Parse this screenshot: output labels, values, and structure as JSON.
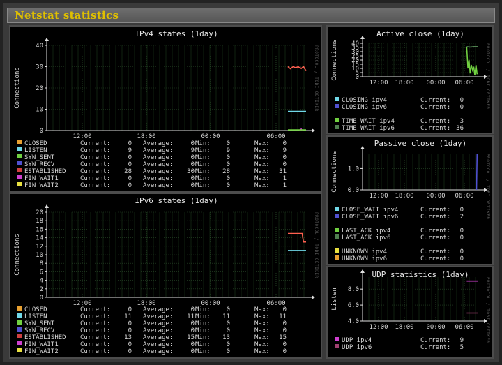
{
  "window": {
    "title": "Netstat statistics"
  },
  "watermark": "PROTOCOL / TOBI OETIKER",
  "panels": [
    {
      "id": "ipv4",
      "title": "IPv4 states  (1day)",
      "ylabel": "Connections",
      "yticks": [
        0,
        10,
        20,
        30,
        40
      ],
      "xticks": [
        "12:00",
        "18:00",
        "00:00",
        "06:00"
      ],
      "stats_cols": [
        "Current:",
        "Average:",
        "Min:",
        "Max:"
      ],
      "legend": [
        {
          "name": "CLOSED",
          "color": "#e8a030",
          "current": "0",
          "average": "0",
          "min": "0",
          "max": "0"
        },
        {
          "name": "LISTEN",
          "color": "#70d8e8",
          "current": "9",
          "average": "9",
          "min": "9",
          "max": "9"
        },
        {
          "name": "SYN_SENT",
          "color": "#70d040",
          "current": "0",
          "average": "0",
          "min": "0",
          "max": "0"
        },
        {
          "name": "SYN_RECV",
          "color": "#5050d0",
          "current": "0",
          "average": "0",
          "min": "0",
          "max": "0"
        },
        {
          "name": "ESTABLISHED",
          "color": "#d04040",
          "current": "28",
          "average": "30",
          "min": "28",
          "max": "31"
        },
        {
          "name": "FIN_WAIT1",
          "color": "#d040d0",
          "current": "0",
          "average": "0",
          "min": "0",
          "max": "1"
        },
        {
          "name": "FIN_WAIT2",
          "color": "#e8e040",
          "current": "0",
          "average": "0",
          "min": "0",
          "max": "1"
        }
      ]
    },
    {
      "id": "ipv6",
      "title": "IPv6 states  (1day)",
      "ylabel": "Connections",
      "yticks": [
        0,
        2,
        4,
        6,
        8,
        10,
        12,
        14,
        16,
        18,
        20
      ],
      "xticks": [
        "12:00",
        "18:00",
        "00:00",
        "06:00"
      ],
      "stats_cols": [
        "Current:",
        "Average:",
        "Min:",
        "Max:"
      ],
      "legend": [
        {
          "name": "CLOSED",
          "color": "#e8a030",
          "current": "0",
          "average": "0",
          "min": "0",
          "max": "0"
        },
        {
          "name": "LISTEN",
          "color": "#70d8e8",
          "current": "11",
          "average": "11",
          "min": "11",
          "max": "11"
        },
        {
          "name": "SYN_SENT",
          "color": "#70d040",
          "current": "0",
          "average": "0",
          "min": "0",
          "max": "0"
        },
        {
          "name": "SYN_RECV",
          "color": "#5050d0",
          "current": "0",
          "average": "0",
          "min": "0",
          "max": "0"
        },
        {
          "name": "ESTABLISHED",
          "color": "#d04040",
          "current": "13",
          "average": "15",
          "min": "13",
          "max": "15"
        },
        {
          "name": "FIN_WAIT1",
          "color": "#d040d0",
          "current": "0",
          "average": "0",
          "min": "0",
          "max": "0"
        },
        {
          "name": "FIN_WAIT2",
          "color": "#e8e040",
          "current": "0",
          "average": "0",
          "min": "0",
          "max": "0"
        }
      ]
    },
    {
      "id": "active",
      "title": "Active close  (1day)",
      "ylabel": "Connections",
      "yticks": [
        0,
        5,
        10,
        15,
        20,
        25,
        30,
        35,
        40
      ],
      "xticks": [
        "12:00",
        "18:00",
        "00:00",
        "06:00"
      ],
      "stats_cols": [
        "Current:"
      ],
      "legend": [
        {
          "name": "CLOSING ipv4",
          "color": "#70d8e8",
          "current": "0"
        },
        {
          "name": "CLOSING ipv6",
          "color": "#5050d0",
          "current": "0"
        },
        {
          "name": "TIME_WAIT ipv4",
          "color": "#70d040",
          "current": "3"
        },
        {
          "name": "TIME_WAIT ipv6",
          "color": "#508050",
          "current": "36"
        }
      ]
    },
    {
      "id": "passive",
      "title": "Passive close  (1day)",
      "ylabel": "Connections",
      "yticks": [
        "0.0",
        "1.0"
      ],
      "xticks": [
        "12:00",
        "18:00",
        "00:00",
        "06:00"
      ],
      "stats_cols": [
        "Current:"
      ],
      "legend": [
        {
          "name": "CLOSE_WAIT ipv4",
          "color": "#70d8e8",
          "current": "0"
        },
        {
          "name": "CLOSE_WAIT ipv6",
          "color": "#5050d0",
          "current": "2"
        },
        {
          "name": "LAST_ACK ipv4",
          "color": "#70d040",
          "current": "0"
        },
        {
          "name": "LAST_ACK ipv6",
          "color": "#508050",
          "current": "0"
        },
        {
          "name": "UNKNOWN ipv4",
          "color": "#e8e040",
          "current": "0"
        },
        {
          "name": "UNKNOWN ipv6",
          "color": "#e8a030",
          "current": "0"
        }
      ]
    },
    {
      "id": "udp",
      "title": "UDP statistics  (1day)",
      "ylabel": "Listen",
      "yticks": [
        "4.0",
        "6.0",
        "8.0"
      ],
      "xticks": [
        "12:00",
        "18:00",
        "00:00",
        "06:00"
      ],
      "stats_cols": [
        "Current:"
      ],
      "legend": [
        {
          "name": "UDP ipv4",
          "color": "#d040d0",
          "current": "9"
        },
        {
          "name": "UDP ipv6",
          "color": "#a04070",
          "current": "5"
        }
      ]
    }
  ],
  "chart_data": [
    {
      "type": "line",
      "title": "IPv4 states  (1day)",
      "ylabel": "Connections",
      "ylim": [
        0,
        40
      ],
      "x": [
        "12:00",
        "18:00",
        "00:00",
        "06:00"
      ],
      "series": [
        {
          "name": "LISTEN",
          "values": [
            9,
            9,
            9,
            9
          ]
        },
        {
          "name": "ESTABLISHED",
          "values": [
            30,
            30,
            29,
            28
          ]
        },
        {
          "name": "FIN_WAIT1",
          "values": [
            0,
            1,
            0,
            0
          ]
        }
      ]
    },
    {
      "type": "line",
      "title": "IPv6 states  (1day)",
      "ylabel": "Connections",
      "ylim": [
        0,
        20
      ],
      "x": [
        "12:00",
        "18:00",
        "00:00",
        "06:00"
      ],
      "series": [
        {
          "name": "LISTEN",
          "values": [
            11,
            11,
            11,
            11
          ]
        },
        {
          "name": "ESTABLISHED",
          "values": [
            15,
            15,
            15,
            13
          ]
        }
      ]
    },
    {
      "type": "line",
      "title": "Active close  (1day)",
      "ylabel": "Connections",
      "ylim": [
        0,
        40
      ],
      "x": [
        "12:00",
        "18:00",
        "00:00",
        "06:00"
      ],
      "series": [
        {
          "name": "TIME_WAIT ipv4",
          "values": [
            35,
            3,
            12,
            3
          ]
        },
        {
          "name": "TIME_WAIT ipv6",
          "values": [
            36,
            36,
            36,
            36
          ]
        }
      ]
    },
    {
      "type": "line",
      "title": "Passive close  (1day)",
      "ylabel": "Connections",
      "ylim": [
        0,
        1.7
      ],
      "x": [
        "12:00",
        "18:00",
        "00:00",
        "06:00"
      ],
      "series": [
        {
          "name": "CLOSE_WAIT ipv6",
          "values": [
            0,
            0,
            0,
            2
          ]
        }
      ]
    },
    {
      "type": "line",
      "title": "UDP statistics  (1day)",
      "ylabel": "Listen",
      "ylim": [
        4,
        9.5
      ],
      "x": [
        "12:00",
        "18:00",
        "00:00",
        "06:00"
      ],
      "series": [
        {
          "name": "UDP ipv4",
          "values": [
            9,
            9,
            9,
            9
          ]
        },
        {
          "name": "UDP ipv6",
          "values": [
            5,
            5,
            5,
            5
          ]
        }
      ]
    }
  ]
}
